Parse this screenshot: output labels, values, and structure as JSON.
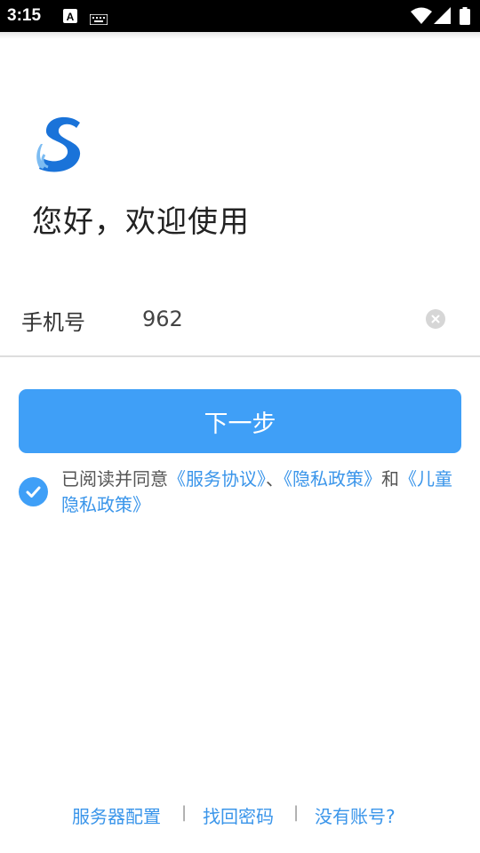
{
  "status_bar": {
    "time": "3:15",
    "icons": [
      "a-notification-icon",
      "keyboard-icon",
      "wifi-icon",
      "signal-icon",
      "battery-icon"
    ]
  },
  "logo": {
    "icon": "s-logo-icon",
    "color": "#1a73d9"
  },
  "welcome_text": "您好，欢迎使用",
  "phone": {
    "label": "手机号",
    "value": "962",
    "clear_icon": "clear-icon"
  },
  "next_button": {
    "label": "下一步",
    "color": "#3f9ff7"
  },
  "agreement": {
    "checked": true,
    "prefix": "已阅读并同意",
    "link_service": "《服务协议》",
    "sep1": "、",
    "link_privacy": "《隐私政策》",
    "and": "和",
    "link_child_privacy": "《儿童隐私政策》"
  },
  "footer": {
    "server_config": "服务器配置",
    "separator": "|",
    "forgot_password": "找回密码",
    "no_account": "没有账号?"
  },
  "colors": {
    "accent": "#3f9ff7",
    "link": "#3a95ea",
    "status_bar": "#000000"
  }
}
